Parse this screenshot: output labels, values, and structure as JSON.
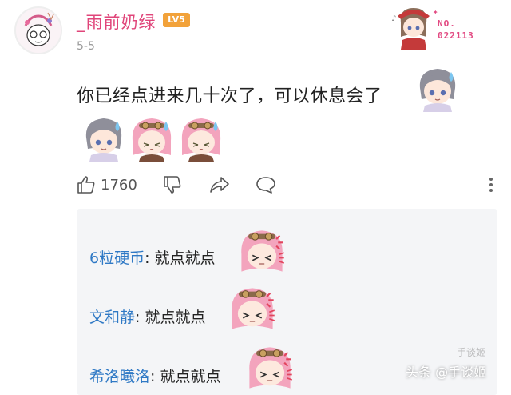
{
  "post": {
    "username": "_雨前奶绿",
    "level": "LV5",
    "date": "5-5",
    "badge_line1": "NO.",
    "badge_line2": "022113",
    "content": "你已经点进来几十次了，可以休息会了"
  },
  "actions": {
    "like_count": "1760",
    "like_icon": "thumbs-up-icon",
    "dislike_icon": "thumbs-down-icon",
    "share_icon": "share-icon",
    "comment_icon": "comment-icon",
    "more_icon": "more-icon"
  },
  "replies": [
    {
      "name": "6粒硬币",
      "text": ": 就点就点"
    },
    {
      "name": "文和静",
      "text": ": 就点就点"
    },
    {
      "name": "希洛曦洛",
      "text": ": 就点就点"
    }
  ],
  "watermark": {
    "text": "头条 @手谈姬",
    "faint": "手谈姬"
  },
  "colors": {
    "username": "#e0457a",
    "reply_name": "#2f79c5",
    "level_badge": "#f2a23a",
    "reply_bg": "#f4f5f7"
  }
}
